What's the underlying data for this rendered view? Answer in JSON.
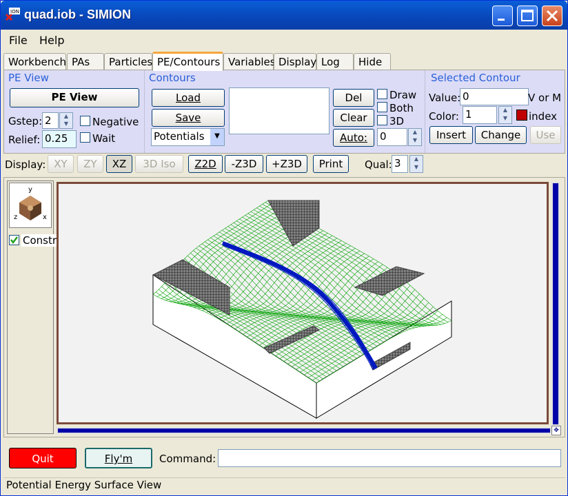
{
  "window": {
    "title": "quad.iob - SIMION"
  },
  "menu": [
    "File",
    "Help"
  ],
  "tabs": [
    "Workbench",
    "PAs",
    "Particles",
    "PE/Contours",
    "Variables",
    "Display",
    "Log",
    "Hide"
  ],
  "pe_view": {
    "group_title": "PE View",
    "button": "PE View",
    "gstep_label": "Gstep:",
    "gstep_value": "2",
    "relief_label": "Relief:",
    "relief_value": "0.25",
    "negative_label": "Negative",
    "wait_label": "Wait"
  },
  "contours": {
    "group_title": "Contours",
    "load": "Load",
    "save": "Save",
    "select_value": "Potentials",
    "del": "Del",
    "clear": "Clear",
    "auto": "Auto:",
    "auto_value": "0",
    "draw_label": "Draw",
    "both_label": "Both",
    "d3_label": "3D"
  },
  "selected_contour": {
    "group_title": "Selected Contour",
    "value_label": "Value:",
    "value": "0",
    "unit_label": "V or M",
    "color_label": "Color:",
    "color_value": "1",
    "color_swatch": "#c00000",
    "index_label": "index",
    "insert": "Insert",
    "change": "Change",
    "use": "Use"
  },
  "toolbar": {
    "display_label": "Display:",
    "xy": "XY",
    "zy": "ZY",
    "xz": "XZ",
    "iso": "3D Iso",
    "z2d": "Z2D",
    "mz3d": "-Z3D",
    "pz3d": "+Z3D",
    "print": "Print",
    "qual_label": "Qual:",
    "qual_value": "3"
  },
  "side": {
    "axis_y": "y",
    "axis_z": "z",
    "axis_x": "x",
    "constrain_label": "Constrn"
  },
  "bottom": {
    "quit": "Quit",
    "flym": "Fly'm",
    "command_label": "Command:",
    "command_value": ""
  },
  "status": "Potential Energy Surface View",
  "colors": {
    "mesh": "#00a000",
    "beam": "#0018c0",
    "electrode": "#404040",
    "quit_bg": "#ff0000"
  }
}
